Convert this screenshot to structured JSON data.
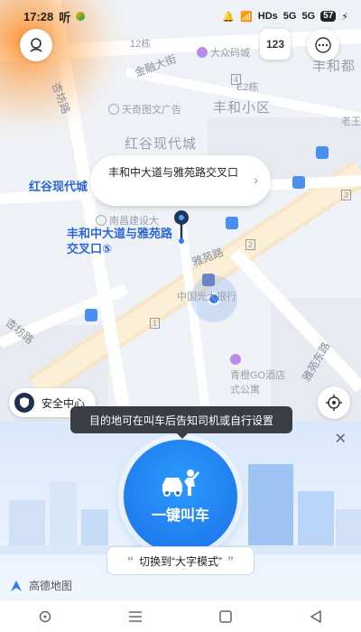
{
  "status_bar": {
    "time": "17:28",
    "listen_label": "听",
    "network_hd": "HDs",
    "signal_1": "5G",
    "signal_2": "5G",
    "battery": "57"
  },
  "map": {
    "roads": [
      "金融大街",
      "天奇图文广告",
      "杏坊路",
      "雅苑路",
      "雅苑东路",
      "杏坊路"
    ],
    "areas": [
      "丰和小区",
      "红谷现代城",
      "丰和都"
    ],
    "pois": [
      "大众码城",
      "E2栋",
      "12栋",
      "南昌建设大",
      "中国光大银行",
      "青橙GO酒店式公寓",
      "老王"
    ],
    "route_markers": [
      "4",
      "2",
      "1",
      "3",
      "5"
    ],
    "top_left_icon": "avatar-icon",
    "plate_button": "123",
    "more_icon": "more-icon",
    "location_label": "红谷现代城",
    "pin_label": "丰和中大道与雅苑路交叉口",
    "pin_label_suffix": "⑤"
  },
  "destination_bubble": {
    "text": "丰和中大道与雅苑路交叉口"
  },
  "safety_center": {
    "label": "安全中心"
  },
  "tooltip": {
    "text": "目的地可在叫车后告知司机或自行设置"
  },
  "call_button": {
    "label": "一键叫车"
  },
  "mode_switch": {
    "label": "切换到“大字模式”"
  },
  "brand": {
    "name": "高德地图"
  },
  "navbar": {
    "items": [
      "circle-nav-icon",
      "menu-nav-icon",
      "home-square-icon",
      "back-triangle-icon"
    ]
  },
  "colors": {
    "primary": "#1a6fe6",
    "label_blue": "#2a64d6",
    "tooltip_bg": "#3a3d44",
    "map_bg": "#eef1f5"
  }
}
